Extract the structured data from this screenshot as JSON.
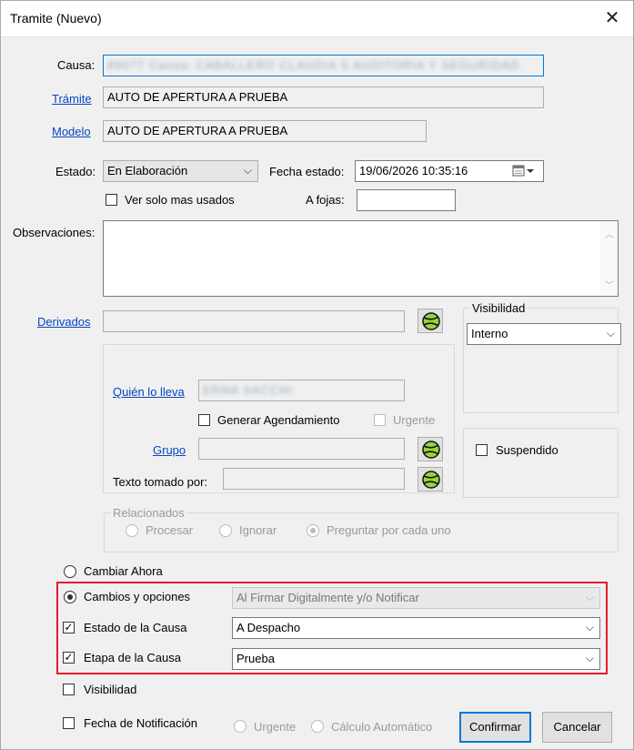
{
  "window": {
    "title": "Tramite  (Nuevo)"
  },
  "colors": {
    "highlight_box": "#e21c2a",
    "link": "#0645c2",
    "default_button_border": "#0078d7"
  },
  "form": {
    "causa_label": "Causa:",
    "causa_value": "89077 Causa: CABALLERO CLAUDIA S AUDITORIA Y SEGURIDAD",
    "tramite_label": "Trámite",
    "tramite_value": "AUTO DE APERTURA A PRUEBA",
    "modelo_label": "Modelo",
    "modelo_value": "AUTO DE APERTURA A PRUEBA",
    "estado_label": "Estado:",
    "estado_value": "En Elaboración",
    "fecha_estado_label": "Fecha estado:",
    "fecha_estado_value": "19/06/2026 10:35:16",
    "ver_solo_label": "Ver solo mas usados",
    "ver_solo_checked": false,
    "afojas_label": "A fojas:",
    "afojas_value": "",
    "observaciones_label": "Observaciones:",
    "observaciones_value": "",
    "derivados_label": "Derivados",
    "derivados_value": "",
    "quien_label": "Quién lo lleva",
    "quien_value": "ERNA SACCHI",
    "generar_label": "Generar Agendamiento",
    "urgente_label": "Urgente",
    "grupo_label": "Grupo",
    "grupo_value": "",
    "texto_label": "Texto tomado por:",
    "texto_value": "",
    "visibilidad_group": "Visibilidad",
    "visibilidad_value": "Interno",
    "suspendido_label": "Suspendido",
    "relacionados": {
      "title": "Relacionados",
      "options": [
        "Procesar",
        "Ignorar",
        "Preguntar por cada uno"
      ],
      "selected": "Preguntar por cada uno"
    }
  },
  "options": {
    "cambiar_ahora_label": "Cambiar Ahora",
    "cambios_label": "Cambios y opciones",
    "cambios_value": "Al Firmar Digitalmente y/o Notificar",
    "estado_causa_label": "Estado de la Causa",
    "estado_causa_value": "A Despacho",
    "estado_causa_checked": true,
    "etapa_causa_label": "Etapa de la Causa",
    "etapa_causa_value": "Prueba",
    "etapa_causa_checked": true,
    "visibilidad_label": "Visibilidad",
    "fecha_notif_label": "Fecha de Notificación",
    "urgente_label": "Urgente",
    "calculo_label": "Cálculo Automático"
  },
  "buttons": {
    "confirmar": "Confirmar",
    "cancelar": "Cancelar"
  },
  "icons": {
    "close": "close-icon",
    "chevron": "chevron-down-icon",
    "calendar": "calendar-icon",
    "lookup": "tennis-ball-icon"
  }
}
